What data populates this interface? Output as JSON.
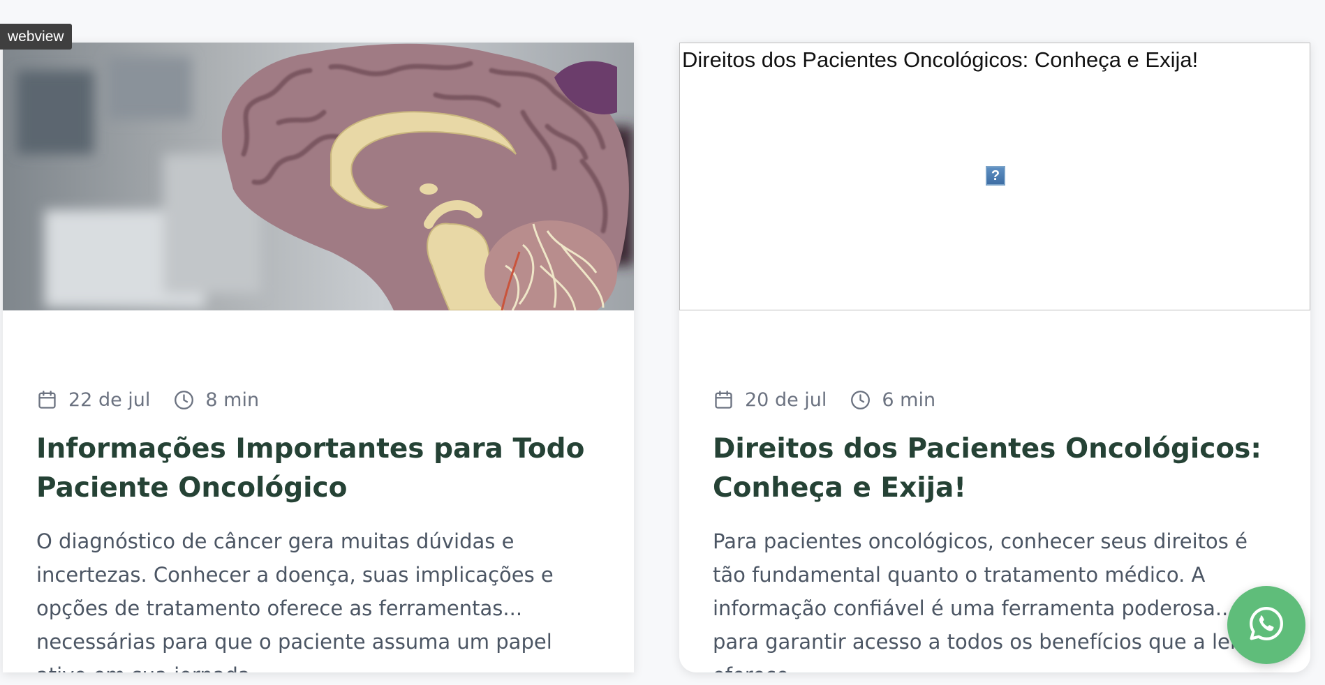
{
  "webview_tag": "webview",
  "cards": [
    {
      "image_alt": "Brain anatomical model",
      "date": "22 de jul",
      "read_time": "8 min",
      "title": "Informações Importantes para Todo Paciente Oncológico",
      "excerpt": "O diagnóstico de câncer gera muitas dúvidas e incertezas. Conhecer a doença, suas implicações e opções de tratamento oferece as ferramentas... necessárias para que o paciente assuma um papel ativo em sua jornada."
    },
    {
      "image_alt": "Direitos dos Pacientes Oncológicos: Conheça e Exija!",
      "broken_image_glyph": "?",
      "date": "20 de jul",
      "read_time": "6 min",
      "title": "Direitos dos Pacientes Oncológicos: Conheça e Exija!",
      "excerpt": "Para pacientes oncológicos, conhecer seus direitos é tão fundamental quanto o tratamento médico. A informação confiável é uma ferramenta poderosa... para garantir acesso a todos os benefícios que a lei oferece."
    }
  ],
  "colors": {
    "page_background": "#f7f8fa",
    "title": "#254235",
    "meta": "#6b7280",
    "excerpt": "#4b5563",
    "whatsapp": "#5fbd7a"
  },
  "icons": {
    "date": "calendar-icon",
    "time": "clock-icon",
    "floating_button": "whatsapp-icon"
  }
}
